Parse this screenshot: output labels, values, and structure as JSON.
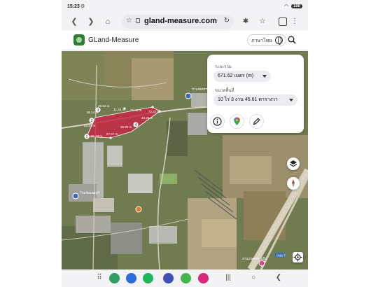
{
  "status_bar": {
    "time": "15:23",
    "battery": "100"
  },
  "browser": {
    "url": "gland-measure.com",
    "tab_count": ""
  },
  "app": {
    "title": "GLand-Measure",
    "language_button": "ภาษาไทย"
  },
  "measure_panel": {
    "perimeter_label": "ระยะรวม",
    "perimeter_value": "671.62 เมตร (m)",
    "area_label": "ขนาดพื้นที่",
    "area_value": "10 ไร่ 3 งาน 45.61 ตารางวา"
  },
  "map": {
    "polygon_color": "#c62845",
    "point_labels": [
      "1",
      "2",
      "3",
      "4"
    ],
    "edge_labels": [
      "56.14 m.",
      "64.94 m.",
      "49.64 m.",
      "41.45 m.",
      "38.06 m.",
      "72.37 m.",
      "40.25 m.",
      "35.90 m.",
      "57.67 m.",
      "91.19 m."
    ],
    "place_labels": [
      "โรงเรียนชลบุรี",
      "บ้านจัดสรรทะเลสาบ",
      "สวนเกษตรบ้านบึง"
    ],
    "road_label": "ถนน 7"
  },
  "colors": {
    "accent": "#2e7d32",
    "polygon": "#c62845"
  }
}
